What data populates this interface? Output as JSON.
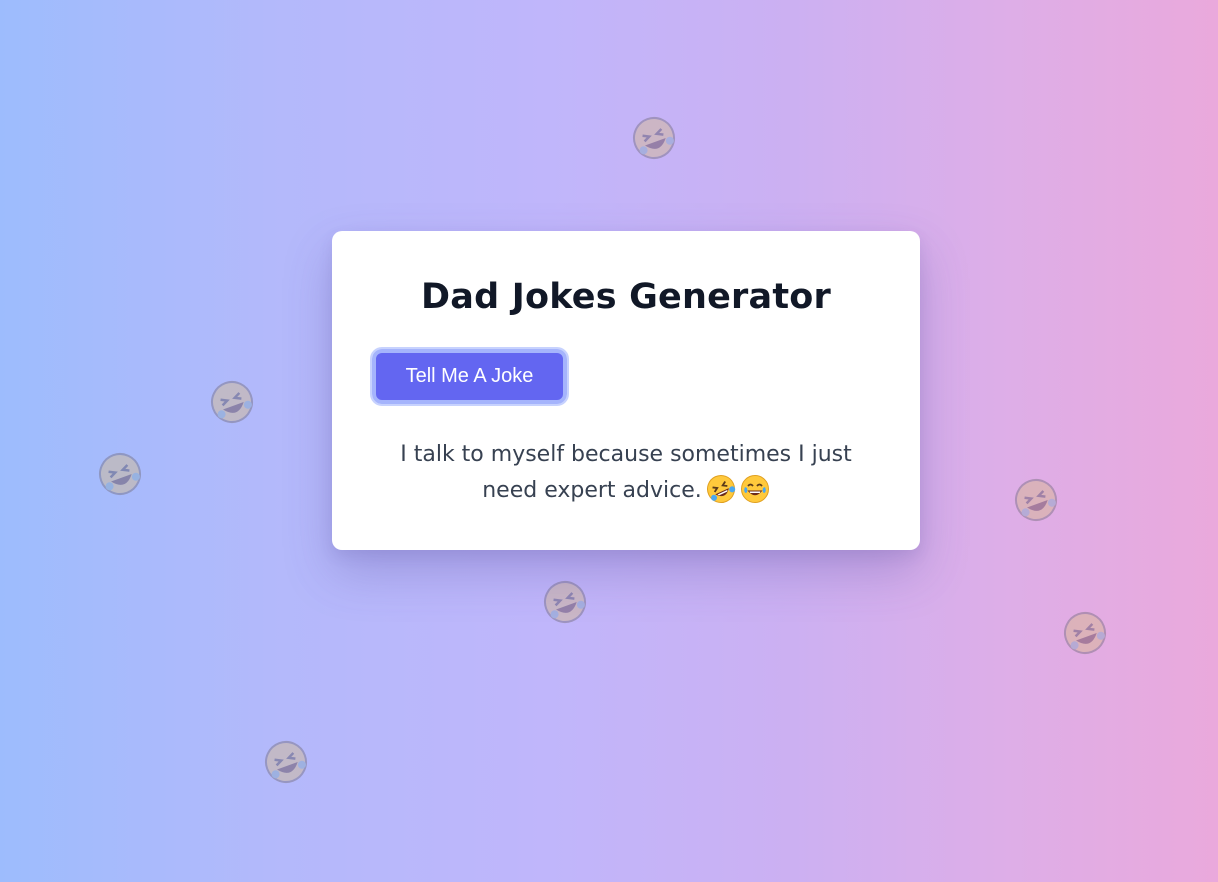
{
  "app": {
    "title": "Dad Jokes Generator",
    "button_label": "Tell Me A Joke",
    "joke_text": "I talk to myself because sometimes I just need expert advice.",
    "joke_emojis": [
      "rolling-on-floor-laughing-emoji",
      "tears-of-joy-emoji"
    ]
  },
  "background": {
    "floating_emoji": "rolling-on-floor-laughing-emoji"
  },
  "colors": {
    "button": "#6366f1",
    "button_ring": "#a5b4fc",
    "title": "#111827",
    "text": "#374151",
    "gradient_start": "#9dbcfd",
    "gradient_end": "#eaa9dc"
  }
}
